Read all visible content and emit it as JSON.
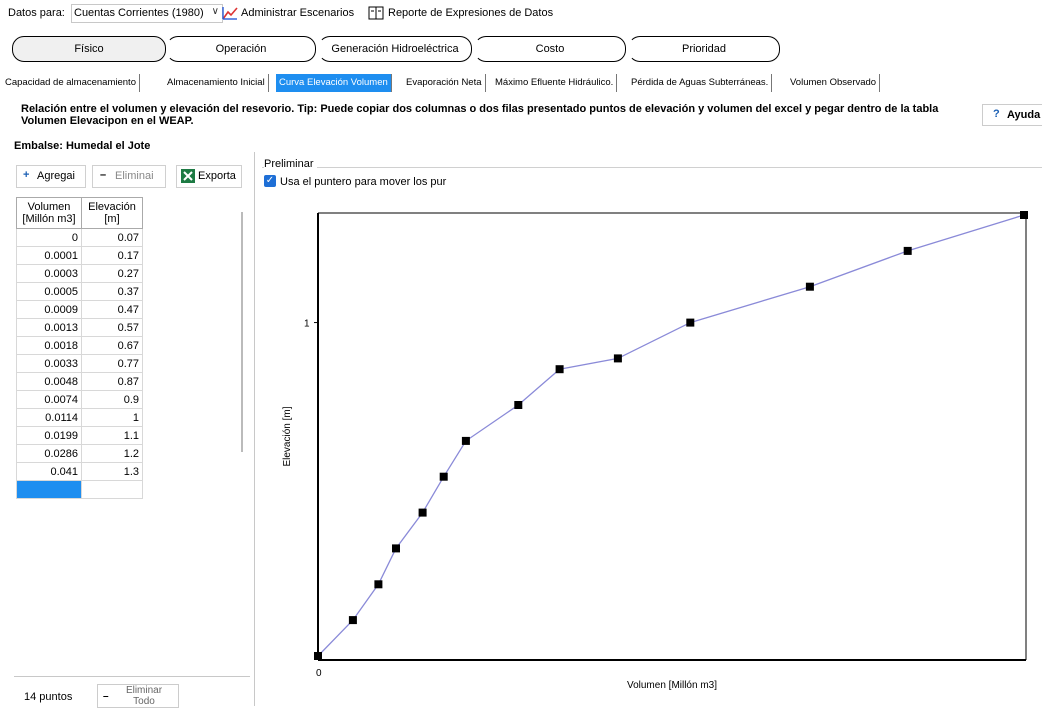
{
  "toolbar": {
    "datos_label": "Datos para:",
    "scenario_value": "Cuentas Corrientes (1980)",
    "manage_scenarios": "Administrar Escenarios",
    "report_expressions": "Reporte de Expresiones de Datos"
  },
  "main_tabs": [
    "Físico",
    "Operación",
    "Generación Hidroeléctrica",
    "Costo",
    "Prioridad"
  ],
  "sub_tabs": [
    "Capacidad de almacenamiento",
    "Almacenamiento Inicial",
    "Curva Elevación Volumen",
    "Evaporación Neta",
    "Máximo Efluente Hidráulico.",
    "Pérdida de Aguas Subterráneas.",
    "Volumen Observado"
  ],
  "description": {
    "line1": "Relación entre el volumen y elevación del resevorio. Tip: Puede copiar dos columnas o dos filas presentado puntos de elevación y volumen del excel y pegar dentro de la tabla",
    "line2": "Volumen Elevacipon en el WEAP."
  },
  "help_label": "Ayuda",
  "embalse_label": "Embalse: Humedal el Jote",
  "left_panel": {
    "add_label": "Agregai",
    "delete_label": "Eliminai",
    "export_label": "Exporta",
    "col1_header_1": "Volumen",
    "col1_header_2": "[Millón m3]",
    "col2_header_1": "Elevación",
    "col2_header_2": "[m]",
    "rows": [
      [
        "0",
        "0.07"
      ],
      [
        "0.0001",
        "0.17"
      ],
      [
        "0.0003",
        "0.27"
      ],
      [
        "0.0005",
        "0.37"
      ],
      [
        "0.0009",
        "0.47"
      ],
      [
        "0.0013",
        "0.57"
      ],
      [
        "0.0018",
        "0.67"
      ],
      [
        "0.0033",
        "0.77"
      ],
      [
        "0.0048",
        "0.87"
      ],
      [
        "0.0074",
        "0.9"
      ],
      [
        "0.0114",
        "1"
      ],
      [
        "0.0199",
        "1.1"
      ],
      [
        "0.0286",
        "1.2"
      ],
      [
        "0.041",
        "1.3"
      ]
    ],
    "points_label": "14 puntos",
    "delete_all_1": "Eliminar",
    "delete_all_2": "Todo"
  },
  "preliminar_label": "Preliminar",
  "checkbox_label": "Usa el puntero para mover los pur",
  "chart_data": {
    "type": "line",
    "xlabel": "Volumen [Millón m3]",
    "ylabel": "Elevación [m]",
    "x_tick": "0",
    "y_tick": "1",
    "xlim": [
      0,
      0.041
    ],
    "ylim": [
      0.07,
      1.3
    ],
    "x": [
      0,
      0.0001,
      0.0003,
      0.0005,
      0.0009,
      0.0013,
      0.0018,
      0.0033,
      0.0048,
      0.0074,
      0.0114,
      0.0199,
      0.0286,
      0.041
    ],
    "y": [
      0.07,
      0.17,
      0.27,
      0.37,
      0.47,
      0.57,
      0.67,
      0.77,
      0.87,
      0.9,
      1,
      1.1,
      1.2,
      1.3
    ],
    "line_color": "#8a8ad8",
    "marker_color": "#000000"
  }
}
